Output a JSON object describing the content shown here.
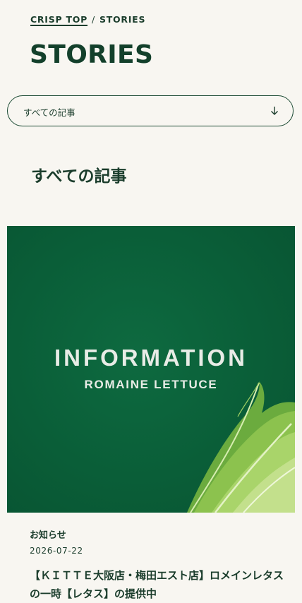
{
  "breadcrumb": {
    "home": "CRISP TOP",
    "separator": "/",
    "current": "STORIES"
  },
  "page": {
    "title": "STORIES"
  },
  "filter": {
    "selected": "すべての記事",
    "icon": "arrow-down-icon"
  },
  "section": {
    "heading": "すべての記事"
  },
  "article": {
    "thumbnail": {
      "line1": "INFORMATION",
      "line2": "ROMAINE LETTUCE",
      "background_color": "#0a5e38"
    },
    "category": "お知らせ",
    "date": "2026-07-22",
    "title": "【ＫＩＴＴＥ大阪店・梅田エスト店】ロメインレタスの一時【レタス】の提供中"
  },
  "colors": {
    "background": "#f8f6f1",
    "text": "#1b3d2c",
    "brand_green": "#13402b"
  }
}
